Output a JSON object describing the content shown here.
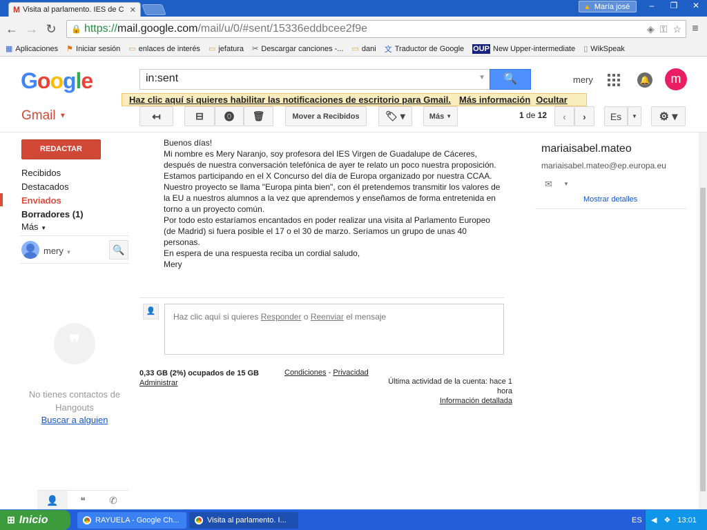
{
  "browser": {
    "tab_title": "Visita al parlamento. IES de C",
    "tab_favicon": "M",
    "user_badge": "María josé",
    "url_https": "https://",
    "url_host": "mail.google.com",
    "url_path": "/mail/u/0/#sent/15336eddbcee2f9e",
    "bookmarks": [
      {
        "label": "Aplicaciones",
        "icon": "apps-grid-icon"
      },
      {
        "label": "Iniciar sesión",
        "icon": "windows-flag-icon"
      },
      {
        "label": "enlaces de interés",
        "icon": "folder-icon"
      },
      {
        "label": "jefatura",
        "icon": "folder-icon"
      },
      {
        "label": "Descargar canciones -...",
        "icon": "download-icon"
      },
      {
        "label": "dani",
        "icon": "folder-icon"
      },
      {
        "label": "Traductor de Google",
        "icon": "translate-icon"
      },
      {
        "label": "New Upper-intermediate",
        "icon": "oup-icon"
      },
      {
        "label": "WikSpeak",
        "icon": "page-icon"
      }
    ]
  },
  "gmail": {
    "search_value": "in:sent",
    "username": "mery",
    "avatar_letter": "m",
    "notification": {
      "text": "Haz clic aquí si quieres habilitar las notificaciones de escritorio para Gmail.",
      "more_info": "Más información",
      "hide": "Ocultar"
    },
    "label": "Gmail",
    "toolbar": {
      "move_inbox": "Mover a Recibidos",
      "more": "Más",
      "lang": "Es"
    },
    "pager": {
      "current": "1",
      "sep": "de",
      "total": "12"
    },
    "compose": "REDACTAR",
    "nav": {
      "inbox": "Recibidos",
      "starred": "Destacados",
      "sent": "Enviados",
      "drafts": "Borradores (1)",
      "more": "Más"
    },
    "hangouts": {
      "me": "mery",
      "no_contacts": "No tienes contactos de Hangouts",
      "find": "Buscar a alguien"
    },
    "message": [
      "Buenos días!",
      "Mi nombre es Mery Naranjo, soy profesora del IES Virgen de Guadalupe de Cáceres, después de nuestra conversación telefónica de ayer te relato un poco nuestra proposición.",
      "Estamos participando en el X Concurso del día de Europa organizado por nuestra CCAA. Nuestro proyecto se llama \"Europa pinta bien\", con él pretendemos transmitir los valores de la EU a nuestros alumnos a la vez que aprendemos y enseñamos de forma entretenida en torno a un proyecto común.",
      "Por todo esto estaríamos encantados en poder realizar una visita al Parlamento Europeo (de Madrid) si fuera posible el 17 o el 30 de marzo. Seríamos un grupo de unas 40 personas.",
      "En espera de una respuesta reciba un cordial saludo,",
      "Mery"
    ],
    "reply": {
      "prefix": "Haz clic aquí si quieres",
      "reply": "Responder",
      "or": "o",
      "forward": "Reenviar",
      "suffix": "el mensaje"
    },
    "footer": {
      "storage": "0,33 GB (2%) ocupados de 15 GB",
      "manage": "Administrar",
      "terms": "Condiciones",
      "dash": "-",
      "privacy": "Privacidad",
      "last_activity": "Última actividad de la cuenta: hace 1 hora",
      "details": "Información detallada"
    },
    "contact": {
      "name": "mariaisabel.mateo",
      "email": "mariaisabel.mateo@ep.europa.eu",
      "show_details": "Mostrar detalles"
    }
  },
  "taskbar": {
    "start": "Inicio",
    "items": [
      "RAYUELA - Google Ch...",
      "Visita al parlamento. I..."
    ],
    "lang": "ES",
    "clock": "13:01"
  },
  "colors": {
    "gmail_red": "#d14836",
    "search_blue": "#4d90fe",
    "avatar_pink": "#e91e63",
    "xp_blue": "#245edb"
  }
}
